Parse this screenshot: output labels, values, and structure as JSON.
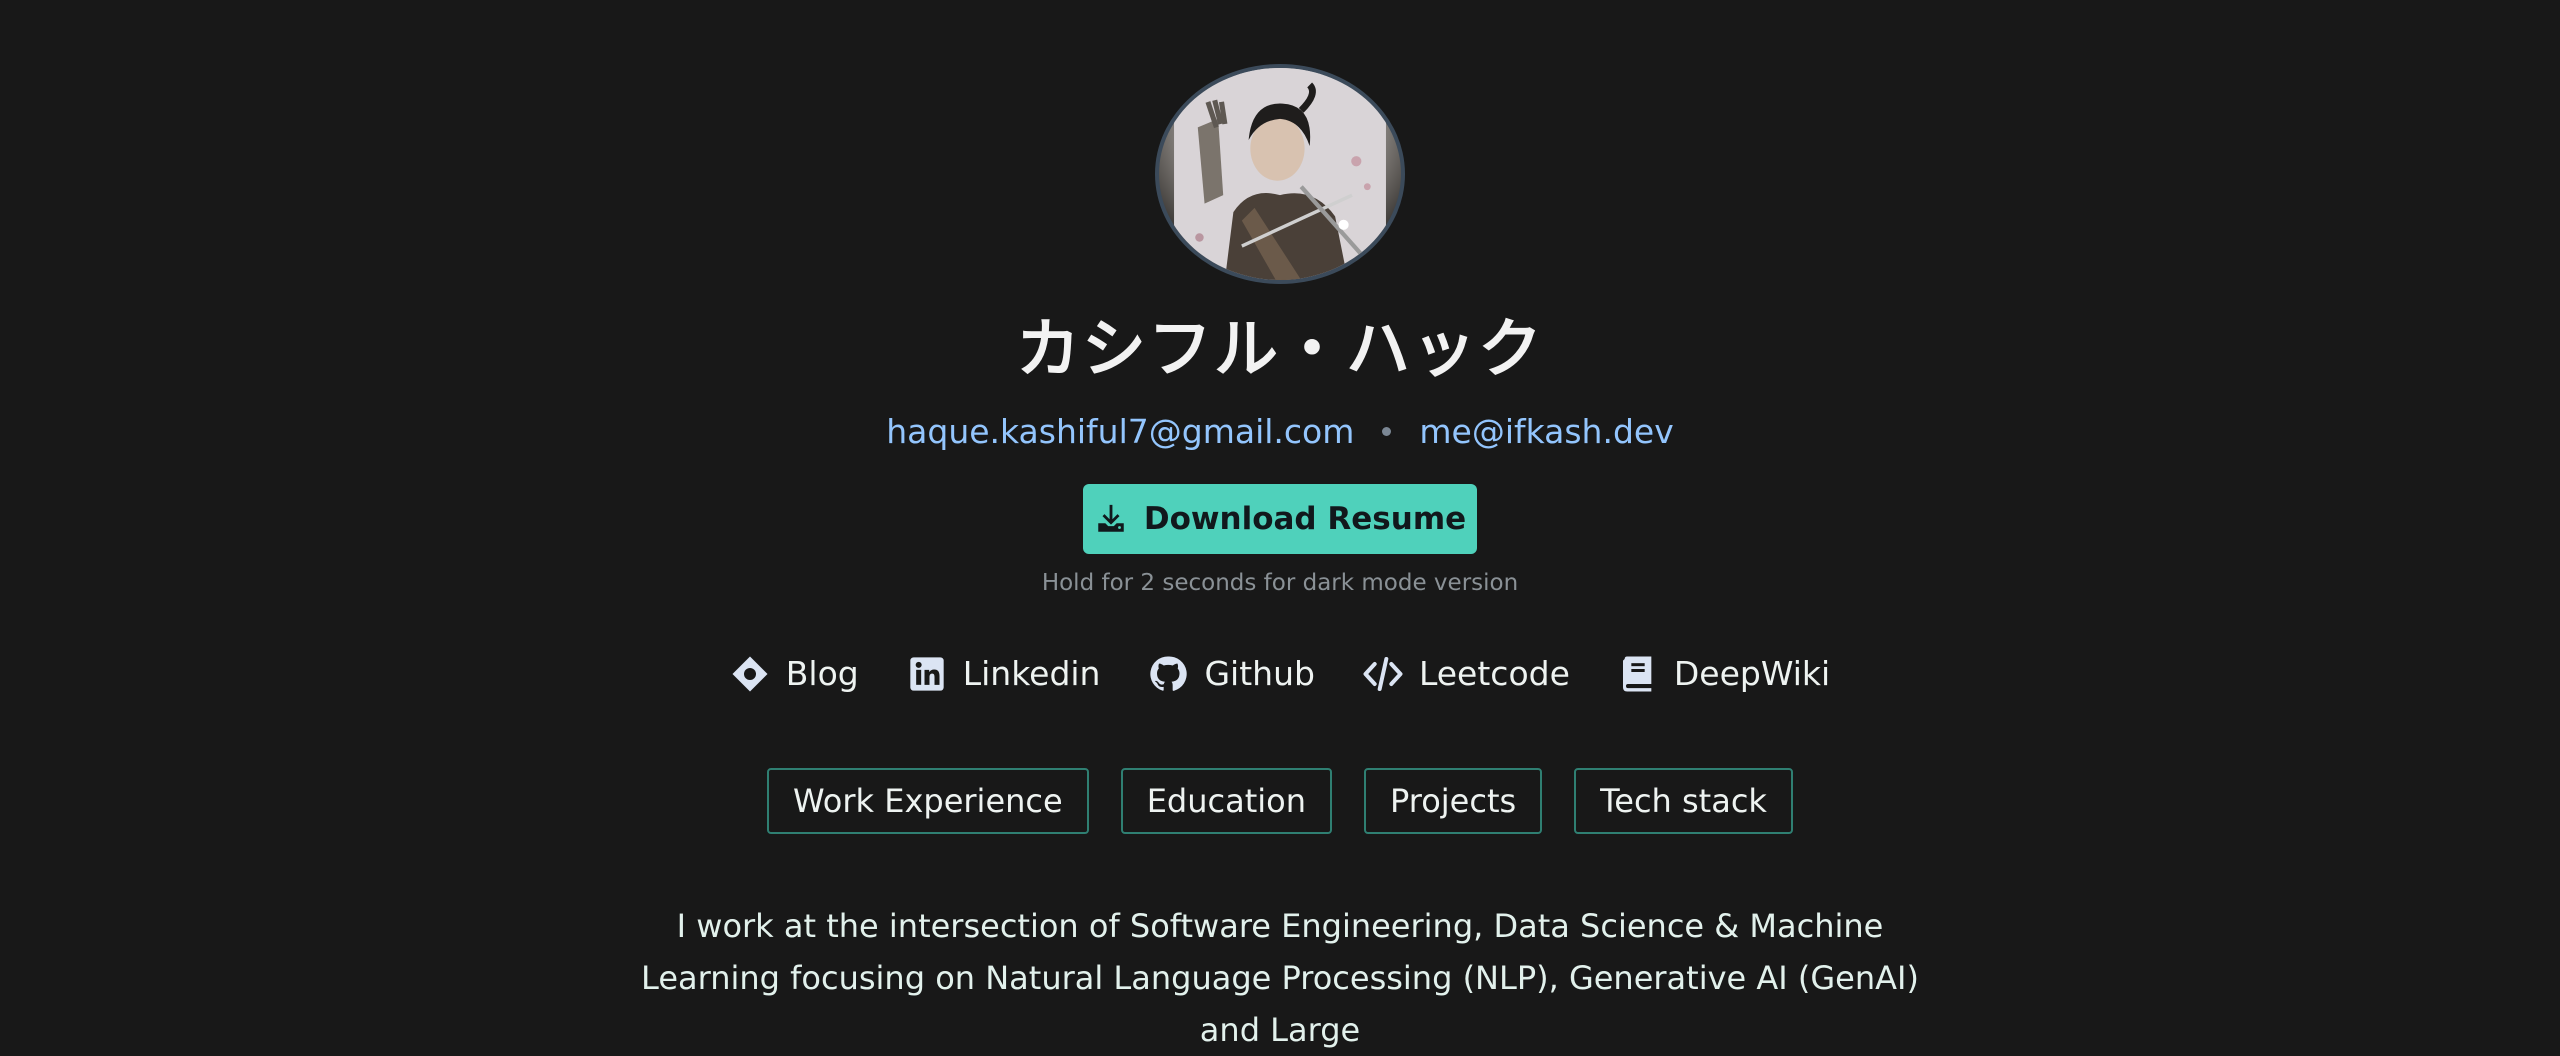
{
  "profile": {
    "name": "カシフル・ハック",
    "email_primary": "haque.kashiful7@gmail.com",
    "email_secondary": "me@ifkash.dev",
    "avatar_icon": "avatar-illustration"
  },
  "download": {
    "label": "Download Resume",
    "hint": "Hold for 2 seconds for dark mode version",
    "icon": "download-icon",
    "color": "#4fd1bb"
  },
  "links": [
    {
      "label": "Blog",
      "icon": "hashnode-icon"
    },
    {
      "label": "Linkedin",
      "icon": "linkedin-icon"
    },
    {
      "label": "Github",
      "icon": "github-icon"
    },
    {
      "label": "Leetcode",
      "icon": "code-icon"
    },
    {
      "label": "DeepWiki",
      "icon": "book-icon"
    }
  ],
  "tabs": [
    {
      "label": "Work Experience"
    },
    {
      "label": "Education"
    },
    {
      "label": "Projects"
    },
    {
      "label": "Tech stack"
    }
  ],
  "bio": {
    "text": "I work at the intersection of Software Engineering, Data Science & Machine Learning focusing on Natural Language Processing (NLP), Generative AI (GenAI) and Large"
  },
  "colors": {
    "background": "#181818",
    "link_blue": "#93c5fd",
    "tab_border": "#2f7f72"
  }
}
